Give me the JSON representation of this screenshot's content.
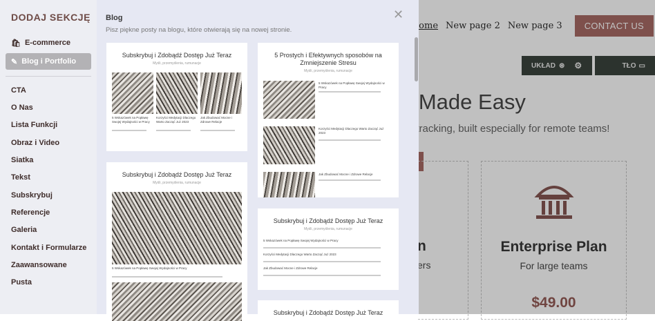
{
  "site": {
    "nav": {
      "home": "Home",
      "page2": "New page 2",
      "page3": "New page 3",
      "contact": "CONTACT US"
    },
    "tools": {
      "layout": "UKŁAD",
      "background": "TŁO"
    },
    "hero_title": "g Made Easy",
    "hero_sub": "t tracking, built especially for remote teams!",
    "plan_left_title": "n",
    "plan_left_sub": "ers",
    "plan_title": "Enterprise Plan",
    "plan_sub": "For large teams",
    "plan_price": "$49.00"
  },
  "sidebar": {
    "heading": "DODAJ SEKCJĘ",
    "categories": [
      {
        "label": "E-commerce",
        "icon": "bag-icon"
      },
      {
        "label": "Blog i Portfolio",
        "icon": "edit-icon",
        "active": true
      }
    ],
    "sections": [
      "CTA",
      "O Nas",
      "Lista Funkcji",
      "Obraz i Video",
      "Siatka",
      "Tekst",
      "Subskrybuj",
      "Referencje",
      "Galeria",
      "Kontakt i Formularze",
      "Zaawansowane",
      "Pusta"
    ]
  },
  "panel": {
    "title": "Blog",
    "description": "Pisz piękne posty na blogu, które otwierają się na nowej stronie.",
    "templates": [
      {
        "title": "Subskrybuj i Zdobądź Dostęp Już Teraz",
        "sub": "Myśli, przemyślenia, rumunacje",
        "captions": [
          "5 Wskazówek na Popławę Swojej Wydajności w Pracy",
          "Korzyści Medytacji Dlaczego Warto Zacząć Już 2023",
          "Jak Zbudować Mocne i Zdrowe Relacje"
        ]
      },
      {
        "title": "5 Prostych i Efektywnych sposobów na Zmniejszenie Stresu",
        "sub": "Myśli, przemyślenia, rumunacje",
        "captions": [
          "5 Wskazówek na Popławę Swojej Wydajności w Pracy",
          "Korzyści Medytacji Dlaczego Warto Zacząć Już 2023",
          "Jak Zbudować Mocne i Zdrowe Relacje"
        ]
      },
      {
        "title": "Subskrybuj i Zdobądź Dostęp Już Teraz",
        "sub": "Myśli, przemyślenia, rumunacje",
        "captions": [
          "5 Wskazówek na Popławę Swojej Wydajności w Pracy"
        ]
      },
      {
        "title": "Subskrybuj i Zdobądź Dostęp Już Teraz",
        "sub": "Myśli, przemyślenia, rumunacje",
        "captions": [
          "5 Wskazówek na Popławę Swojej Wydajności w Pracy",
          "Korzyści Medytacji Dlaczego Warto Zacząć Już 2023",
          "Jak Zbudować Mocne i Zdrowe Relacje"
        ]
      },
      {
        "title": "Subskrybuj i Zdobądź Dostęp Już Teraz",
        "sub": "",
        "captions": []
      }
    ]
  }
}
